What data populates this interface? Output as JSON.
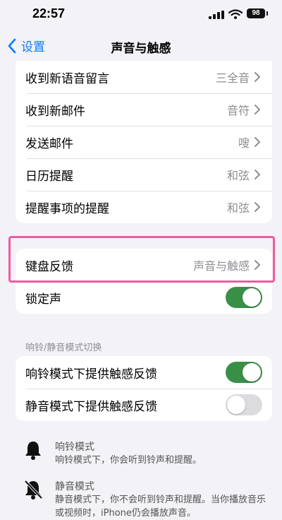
{
  "status": {
    "time": "22:57",
    "battery": "98"
  },
  "nav": {
    "back_label": "设置",
    "title": "声音与触感"
  },
  "alerts": [
    {
      "label": "收到新语音留言",
      "value": "三全音"
    },
    {
      "label": "收到新邮件",
      "value": "音符"
    },
    {
      "label": "发送邮件",
      "value": "嗖"
    },
    {
      "label": "日历提醒",
      "value": "和弦"
    },
    {
      "label": "提醒事项的提醒",
      "value": "和弦"
    }
  ],
  "keyboard": {
    "label": "键盘反馈",
    "value": "声音与触感"
  },
  "lock_sound": {
    "label": "锁定声",
    "on": true
  },
  "ring_section": {
    "header": "响铃/静音模式切换",
    "ring_haptics": {
      "label": "响铃模式下提供触感反馈",
      "on": true
    },
    "silent_haptics": {
      "label": "静音模式下提供触感反馈",
      "on": false
    }
  },
  "info": {
    "ring": {
      "title": "响铃模式",
      "desc": "响铃模式下，你会听到铃声和提醒。"
    },
    "silent": {
      "title": "静音模式",
      "desc": "静音模式下，你不会听到铃声和提醒。当你播放音乐或视频时，iPhone仍会播放声音。"
    }
  },
  "colors": {
    "accent": "#0a7aff",
    "toggle_on": "#3a8f47",
    "highlight": "#f05aa0"
  }
}
